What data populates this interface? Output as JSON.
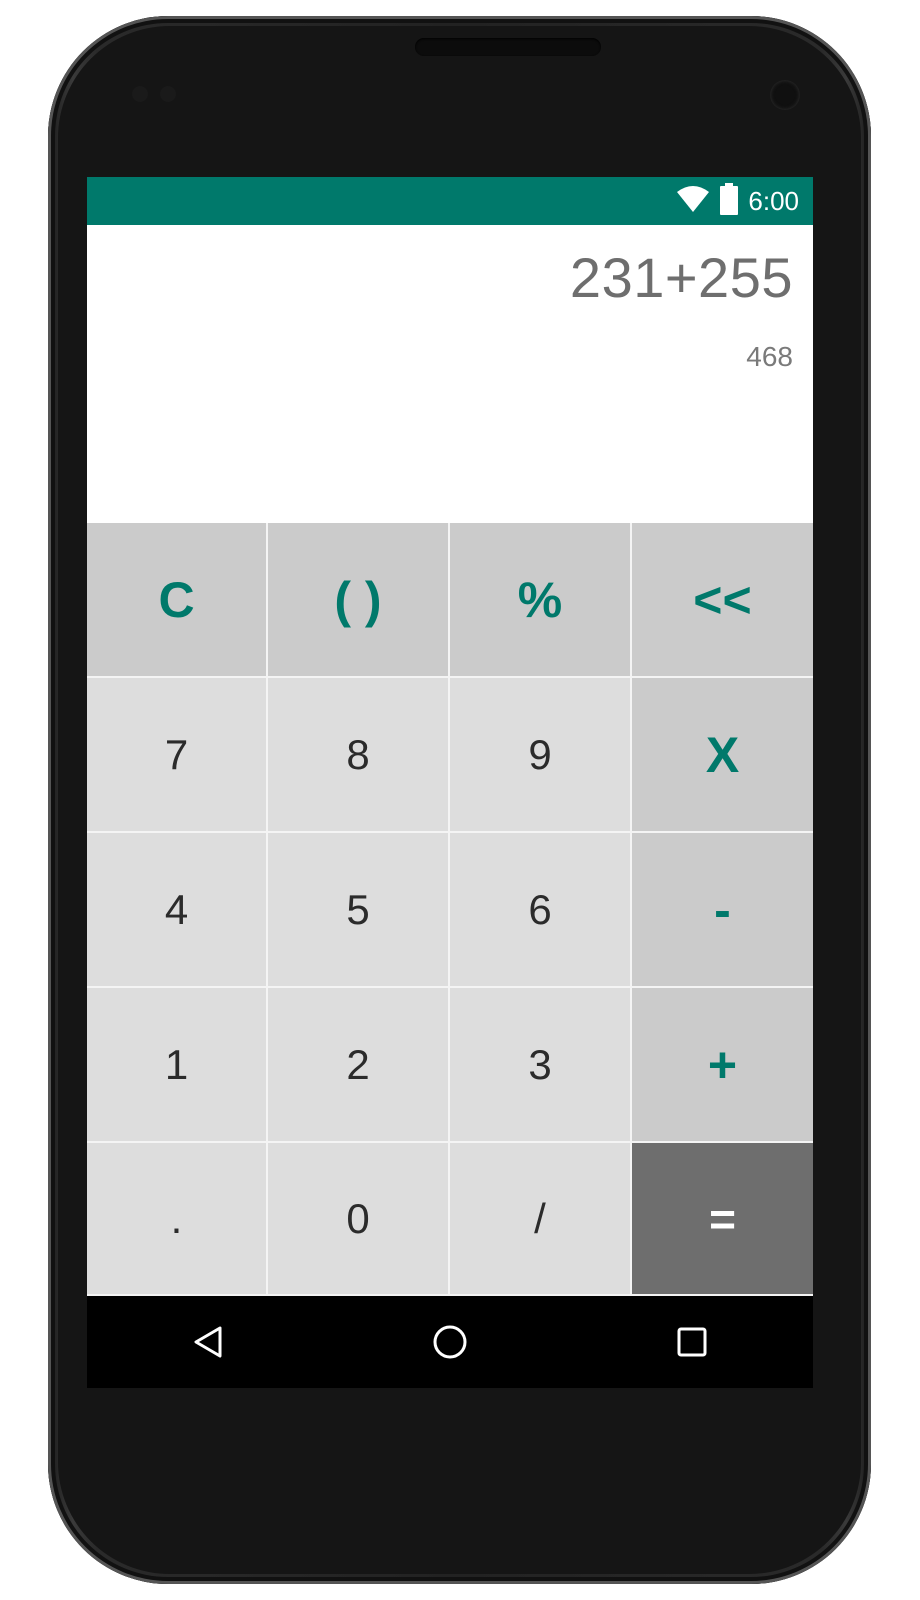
{
  "status_bar": {
    "time": "6:00",
    "icons": [
      "wifi-icon",
      "battery-icon"
    ],
    "color": "#00796b"
  },
  "display": {
    "expression": "231+255",
    "result": "468"
  },
  "keypad": {
    "row1": [
      "C",
      "( )",
      "%",
      "<<"
    ],
    "row2": [
      "7",
      "8",
      "9",
      "X"
    ],
    "row3": [
      "4",
      "5",
      "6",
      "-"
    ],
    "row4": [
      "1",
      "2",
      "3",
      "+"
    ],
    "row5": [
      ".",
      "0",
      "/",
      "="
    ]
  },
  "nav_bar": {
    "icons": [
      "back-icon",
      "home-icon",
      "recents-icon"
    ]
  },
  "colors": {
    "accent": "#00796b",
    "key_function_bg": "#cbcbcb",
    "key_number_bg": "#dddddd",
    "key_equals_bg": "#6e6e6e"
  }
}
